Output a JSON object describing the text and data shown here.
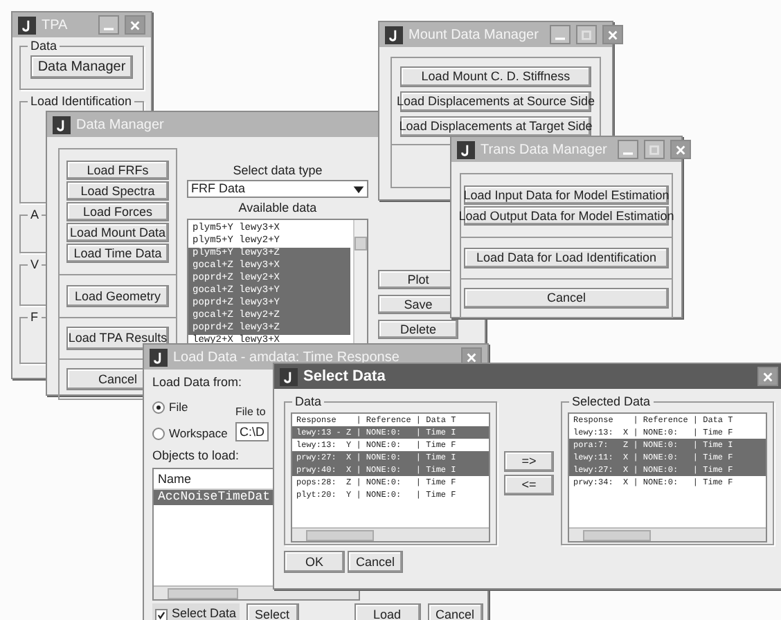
{
  "tpa_window": {
    "title": "TPA",
    "active": false,
    "groups": [
      {
        "label": "Data",
        "buttons": [
          "Data Manager"
        ]
      },
      {
        "label": "Load Identification"
      },
      {
        "label": "A"
      },
      {
        "label": "V"
      },
      {
        "label": "F"
      }
    ]
  },
  "data_manager": {
    "title": "Data Manager",
    "active": false,
    "load_buttons": [
      "Load FRFs",
      "Load Spectra",
      "Load Forces",
      "Load Mount Data",
      "Load Time Data"
    ],
    "geometry_button": "Load Geometry",
    "results_button": "Load TPA Results",
    "cancel_button": "Cancel",
    "select_label": "Select data type",
    "data_type": "FRF Data",
    "available_label": "Available data",
    "available": [
      {
        "text": "plym5+Y lewy3+X",
        "selected": false
      },
      {
        "text": "plym5+Y lewy2+Y",
        "selected": false
      },
      {
        "text": "plym5+Y lewy3+Z",
        "selected": true
      },
      {
        "text": "gocal+Z lewy3+X",
        "selected": true
      },
      {
        "text": "poprd+Z lewy2+X",
        "selected": true
      },
      {
        "text": "gocal+Z lewy3+Y",
        "selected": true
      },
      {
        "text": "poprd+Z lewy3+Y",
        "selected": true
      },
      {
        "text": "gocal+Z lewy2+Z",
        "selected": true
      },
      {
        "text": "poprd+Z lewy3+Z",
        "selected": true
      },
      {
        "text": "lewy2+X lewy3+X",
        "selected": false
      }
    ],
    "actions": [
      "Plot",
      "Save",
      "Delete"
    ]
  },
  "mount_window": {
    "title": "Mount Data Manager",
    "active": false,
    "buttons": [
      "Load Mount C. D. Stiffness",
      "Load Displacements at Source Side",
      "Load Displacements at Target Side"
    ]
  },
  "trans_window": {
    "title": "Trans Data Manager",
    "active": false,
    "buttons": [
      "Load Input Data for Model Estimation",
      "Load Output Data for Model Estimation",
      "Load Data for Load Identification",
      "Cancel"
    ]
  },
  "load_data": {
    "title": "Load Data - amdata: Time Response",
    "active": false,
    "source_label": "Load Data from:",
    "sources": [
      {
        "label": "File",
        "selected": true
      },
      {
        "label": "Workspace",
        "selected": false
      }
    ],
    "file_label": "File to",
    "file_value": "C:\\D",
    "objects_label": "Objects to load:",
    "objects_header": "Name",
    "objects": [
      {
        "text": "AccNoiseTimeDat",
        "selected": true
      }
    ],
    "select_data": {
      "label": "Select Data",
      "checked": true
    },
    "buttons": [
      "Select",
      "Load",
      "Cancel"
    ]
  },
  "select_data": {
    "title": "Select Data",
    "active": true,
    "data_group": {
      "label": "Data",
      "header": "Response    | Reference | Data T",
      "rows": [
        {
          "text": "lewy:13 - Z | NONE:0:   | Time I",
          "selected": true
        },
        {
          "text": "lewy:13:  Y | NONE:0:   | Time F",
          "selected": false
        },
        {
          "text": "prwy:27:  X | NONE:0:   | Time I",
          "selected": true
        },
        {
          "text": "prwy:40:  X | NONE:0:   | Time I",
          "selected": true
        },
        {
          "text": "pops:28:  Z | NONE:0:   | Time F",
          "selected": false
        },
        {
          "text": "plyt:20:  Y | NONE:0:   | Time F",
          "selected": false
        }
      ]
    },
    "selected_group": {
      "label": "Selected Data",
      "header": "Response    | Reference | Data T",
      "rows": [
        {
          "text": "lewy:13:  X | NONE:0:   | Time F",
          "selected": false
        },
        {
          "text": "pora:7:   Z | NONE:0:   | Time I",
          "selected": true
        },
        {
          "text": "lewy:11:  X | NONE:0:   | Time F",
          "selected": true
        },
        {
          "text": "lewy:27:  X | NONE:0:   | Time F",
          "selected": true
        },
        {
          "text": "prwy:34:  X | NONE:0:   | Time F",
          "selected": false
        }
      ]
    },
    "move_buttons": [
      "=>",
      "<="
    ],
    "buttons": [
      "OK",
      "Cancel"
    ]
  }
}
